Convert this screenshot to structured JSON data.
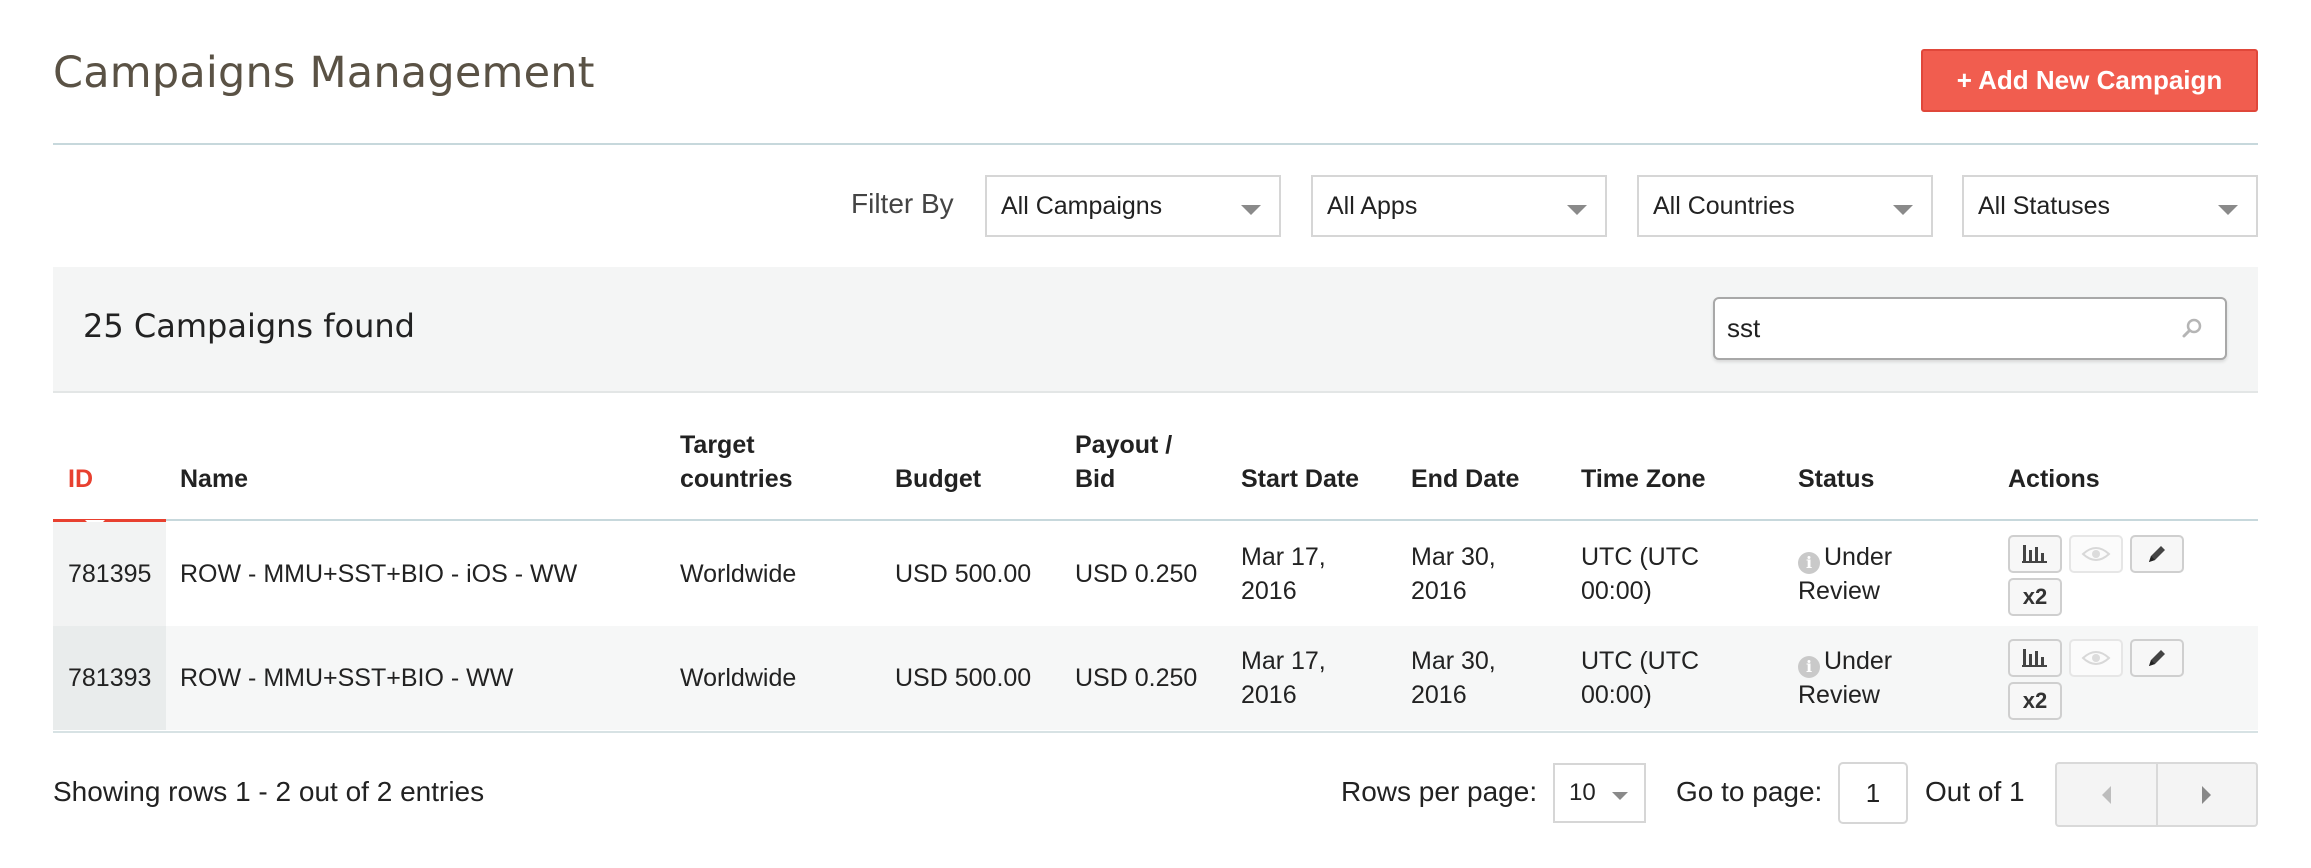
{
  "header": {
    "title": "Campaigns Management",
    "add_button": "+ Add New Campaign"
  },
  "filters": {
    "label": "Filter By",
    "campaigns": "All Campaigns",
    "apps": "All Apps",
    "countries": "All Countries",
    "statuses": "All Statuses"
  },
  "results": {
    "count_text": "25 Campaigns found",
    "search_value": "sst"
  },
  "table": {
    "columns": {
      "id": "ID",
      "name": "Name",
      "target_1": "Target",
      "target_2": "countries",
      "budget": "Budget",
      "payout_1": "Payout /",
      "payout_2": "Bid",
      "start": "Start Date",
      "end": "End Date",
      "tz": "Time Zone",
      "status": "Status",
      "actions": "Actions"
    },
    "rows": [
      {
        "id": "781395",
        "name": "ROW - MMU+SST+BIO - iOS - WW",
        "target": "Worldwide",
        "budget": "USD 500.00",
        "payout": "USD 0.250",
        "start_1": "Mar 17,",
        "start_2": "2016",
        "end_1": "Mar 30,",
        "end_2": "2016",
        "tz_1": "UTC (UTC",
        "tz_2": "00:00)",
        "status_1": "Under",
        "status_2": "Review",
        "dup_label": "x2"
      },
      {
        "id": "781393",
        "name": "ROW - MMU+SST+BIO - WW",
        "target": "Worldwide",
        "budget": "USD 500.00",
        "payout": "USD 0.250",
        "start_1": "Mar 17,",
        "start_2": "2016",
        "end_1": "Mar 30,",
        "end_2": "2016",
        "tz_1": "UTC (UTC",
        "tz_2": "00:00)",
        "status_1": "Under",
        "status_2": "Review",
        "dup_label": "x2"
      }
    ]
  },
  "footer": {
    "showing": "Showing rows 1 - 2 out of 2 entries",
    "rows_per_page_label": "Rows per page:",
    "rows_per_page_value": "10",
    "goto_label": "Go to page:",
    "goto_value": "1",
    "out_of": "Out of 1"
  },
  "colors": {
    "accent": "#f15d4f",
    "active_sort": "#e8402f",
    "title": "#5a5245"
  }
}
